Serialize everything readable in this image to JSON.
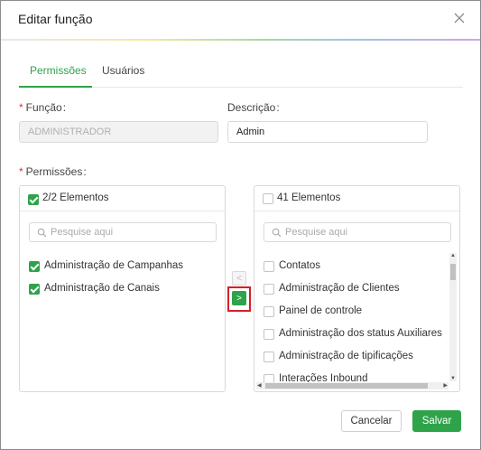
{
  "dialog": {
    "title": "Editar função",
    "close_icon": "close-icon"
  },
  "tabs": [
    {
      "label": "Permissões",
      "active": true
    },
    {
      "label": "Usuários",
      "active": false
    }
  ],
  "form": {
    "funcao_label": "Função",
    "funcao_value": "ADMINISTRADOR",
    "descricao_label": "Descrição",
    "descricao_value": "Admin",
    "permissoes_label": "Permissões",
    "required_mark": "*",
    "colon": ":"
  },
  "left_list": {
    "count_text": "2/2 Elementos",
    "header_checked": true,
    "search_placeholder": "Pesquise aqui",
    "items": [
      {
        "label": "Administração de Campanhas",
        "checked": true
      },
      {
        "label": "Administração de Canais",
        "checked": true
      }
    ]
  },
  "right_list": {
    "count_text": "41 Elementos",
    "header_checked": false,
    "search_placeholder": "Pesquise aqui",
    "items": [
      {
        "label": "Contatos",
        "checked": false
      },
      {
        "label": "Administração de Clientes",
        "checked": false
      },
      {
        "label": "Painel de controle",
        "checked": false
      },
      {
        "label": "Administração dos status Auxiliares",
        "checked": false
      },
      {
        "label": "Administração de tipificações",
        "checked": false
      },
      {
        "label": "Interações Inbound",
        "checked": false
      }
    ]
  },
  "transfer": {
    "left_arrow": "<",
    "right_arrow": ">"
  },
  "footer": {
    "cancel_label": "Cancelar",
    "save_label": "Salvar"
  },
  "colors": {
    "accent": "#2ea34a",
    "required": "#e0322f",
    "highlight": "#d2202b"
  }
}
